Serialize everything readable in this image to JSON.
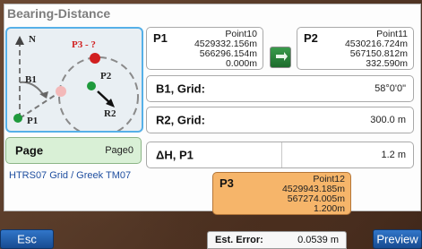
{
  "header": {
    "title": "Bearing-Distance"
  },
  "diagram": {
    "north": "N",
    "p3": "P3 - ?",
    "b1": "B1",
    "p2": "P2",
    "r2": "R2",
    "p1": "P1"
  },
  "p1": {
    "label": "P1",
    "name": "Point10",
    "northing": "4529332.156m",
    "easting": "566296.154m",
    "height": "0.000m"
  },
  "p2": {
    "label": "P2",
    "name": "Point11",
    "northing": "4530216.724m",
    "easting": "567150.812m",
    "height": "332.590m"
  },
  "fields": {
    "b1": {
      "label": "B1, Grid:",
      "value": "58°0'0\""
    },
    "r2": {
      "label": "R2, Grid:",
      "value": "300.0 m"
    },
    "dh": {
      "label": "ΔH, P1",
      "value": "1.2 m"
    }
  },
  "page": {
    "label": "Page",
    "value": "Page0"
  },
  "coord_system": "HTRS07 Grid / Greek TM07",
  "p3": {
    "label": "P3",
    "name": "Point12",
    "northing": "4529943.185m",
    "easting": "567274.005m",
    "height": "1.200m"
  },
  "est_error": {
    "label": "Est. Error:",
    "value": "0.0539 m"
  },
  "buttons": {
    "esc": "Esc",
    "preview": "Preview"
  },
  "colors": {
    "accent_blue": "#56b0e8",
    "page_green": "#d9f0d6",
    "result_orange": "#f6b56a",
    "button_blue": "#3176c9"
  }
}
